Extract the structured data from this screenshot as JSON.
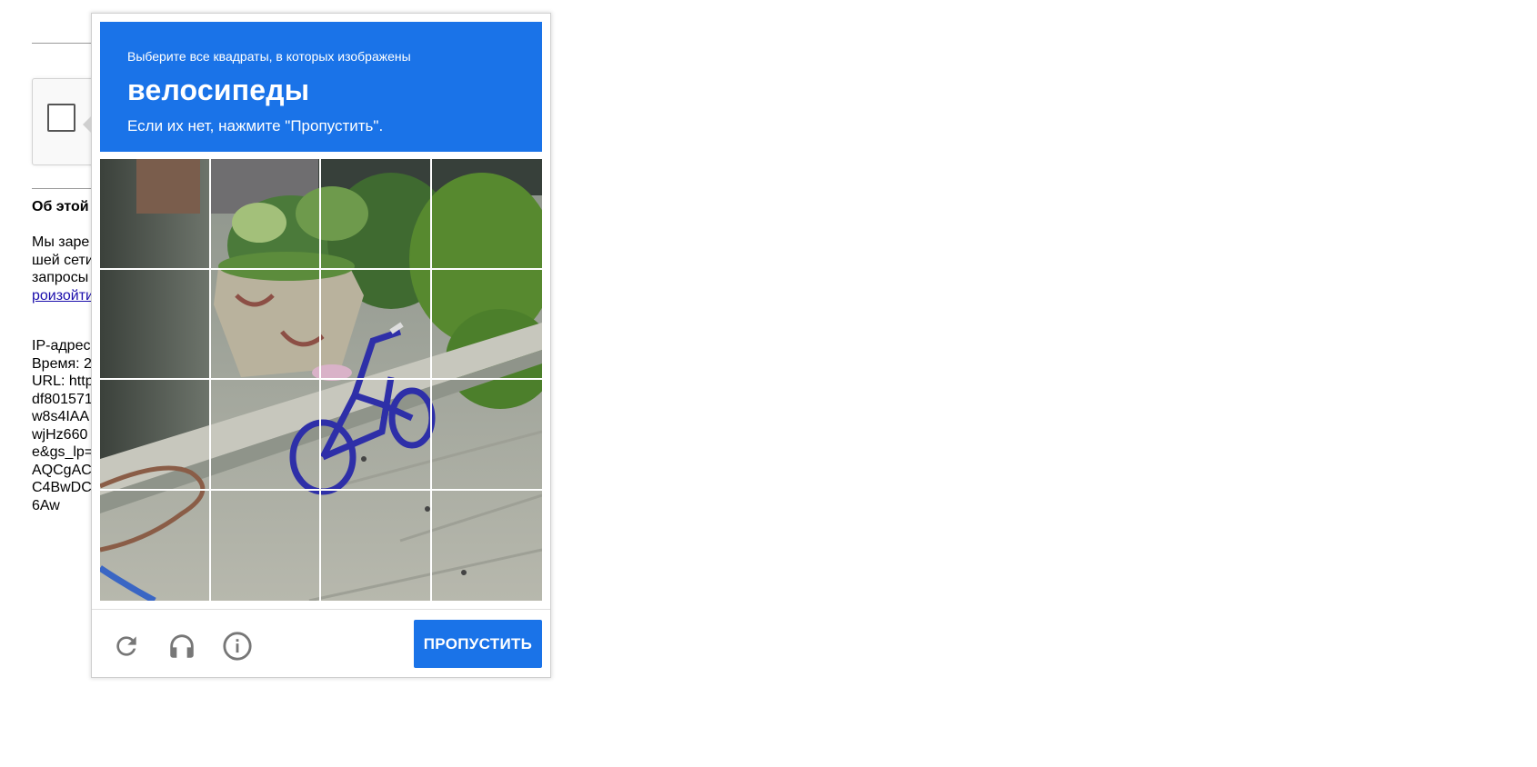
{
  "background_page": {
    "heading": "Об этой",
    "about_lines": [
      "Мы заре",
      "шей сети",
      "запросы"
    ],
    "about_link": "роизойти",
    "ip_lines": [
      "IP-адрес",
      "Время: 2",
      "URL: http",
      "df801571",
      "w8s4IAA",
      "wjHz660",
      "e&gs_lp=",
      "AQCgAC",
      "C4BwDC",
      "6Aw"
    ]
  },
  "challenge": {
    "instruction": "Выберите все квадраты, в которых изображены",
    "target": "велосипеды",
    "hint": "Если их нет, нажмите \"Пропустить\".",
    "image_subject": "bicycle-street-scene",
    "grid": {
      "rows": 4,
      "cols": 4
    },
    "skip_label": "ПРОПУСТИТЬ",
    "icons": [
      "reload-icon",
      "audio-icon",
      "info-icon"
    ]
  },
  "colors": {
    "accent": "#1a73e8",
    "icon_gray": "#777777",
    "link": "#1a0dab"
  }
}
